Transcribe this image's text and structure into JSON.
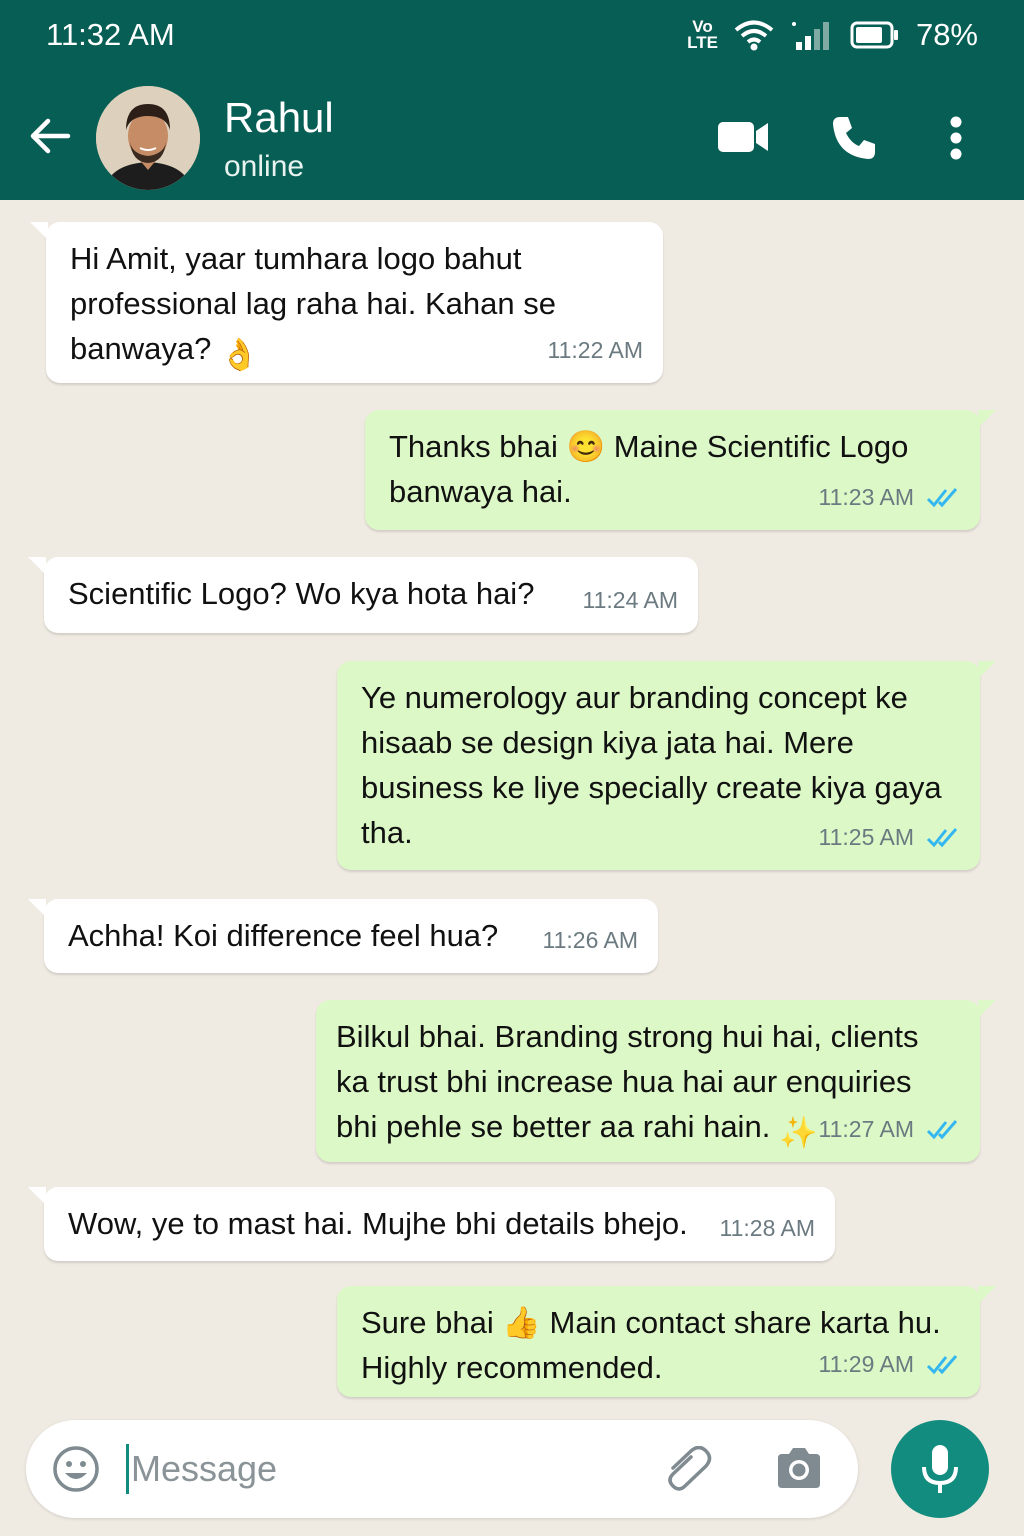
{
  "status_bar": {
    "time": "11:32 AM",
    "volte_top": "Vo",
    "volte_bottom": "LTE",
    "battery": "78%",
    "icons": [
      "volte-icon",
      "wifi-icon",
      "signal-icon",
      "battery-icon"
    ]
  },
  "header": {
    "contact_name": "Rahul",
    "contact_status": "online",
    "icons": [
      "back-arrow-icon",
      "video-call-icon",
      "phone-icon",
      "more-vert-icon"
    ]
  },
  "messages": [
    {
      "direction": "in",
      "text": "Hi Amit, yaar tumhara logo bahut professional lag raha hai. Kahan se banwaya?",
      "emoji": "👌",
      "time": "11:22 AM"
    },
    {
      "direction": "out",
      "text": "Thanks bhai 😊 Maine Scientific Logo banwaya hai.",
      "time": "11:23 AM",
      "read": true
    },
    {
      "direction": "in",
      "text": "Scientific Logo? Wo kya hota hai?",
      "time": "11:24 AM"
    },
    {
      "direction": "out",
      "text": "Ye numerology aur branding concept ke hisaab se design kiya jata hai. Mere business ke liye specially create kiya gaya tha.",
      "time": "11:25 AM",
      "read": true
    },
    {
      "direction": "in",
      "text": "Achha! Koi difference feel hua?",
      "time": "11:26 AM"
    },
    {
      "direction": "out",
      "text": "Bilkul bhai. Branding strong hui hai, clients ka trust bhi increase hua hai aur enquiries bhi pehle se better aa rahi hain.",
      "emoji": "✨",
      "time": "11:27 AM",
      "read": true
    },
    {
      "direction": "in",
      "text": "Wow, ye to mast hai. Mujhe bhi details bhejo.",
      "time": "11:28 AM"
    },
    {
      "direction": "out",
      "text": "Sure bhai 👍 Main contact share karta hu. Highly recommended.",
      "time": "11:29 AM",
      "read": true
    }
  ],
  "composer": {
    "placeholder": "Message",
    "icons": [
      "emoji-icon",
      "attach-icon",
      "camera-icon",
      "mic-icon"
    ]
  },
  "colors": {
    "header": "#075e54",
    "outgoing_bubble": "#dcf8c6",
    "incoming_bubble": "#ffffff",
    "read_ticks": "#34b7f1",
    "mic_button": "#128c7e"
  }
}
